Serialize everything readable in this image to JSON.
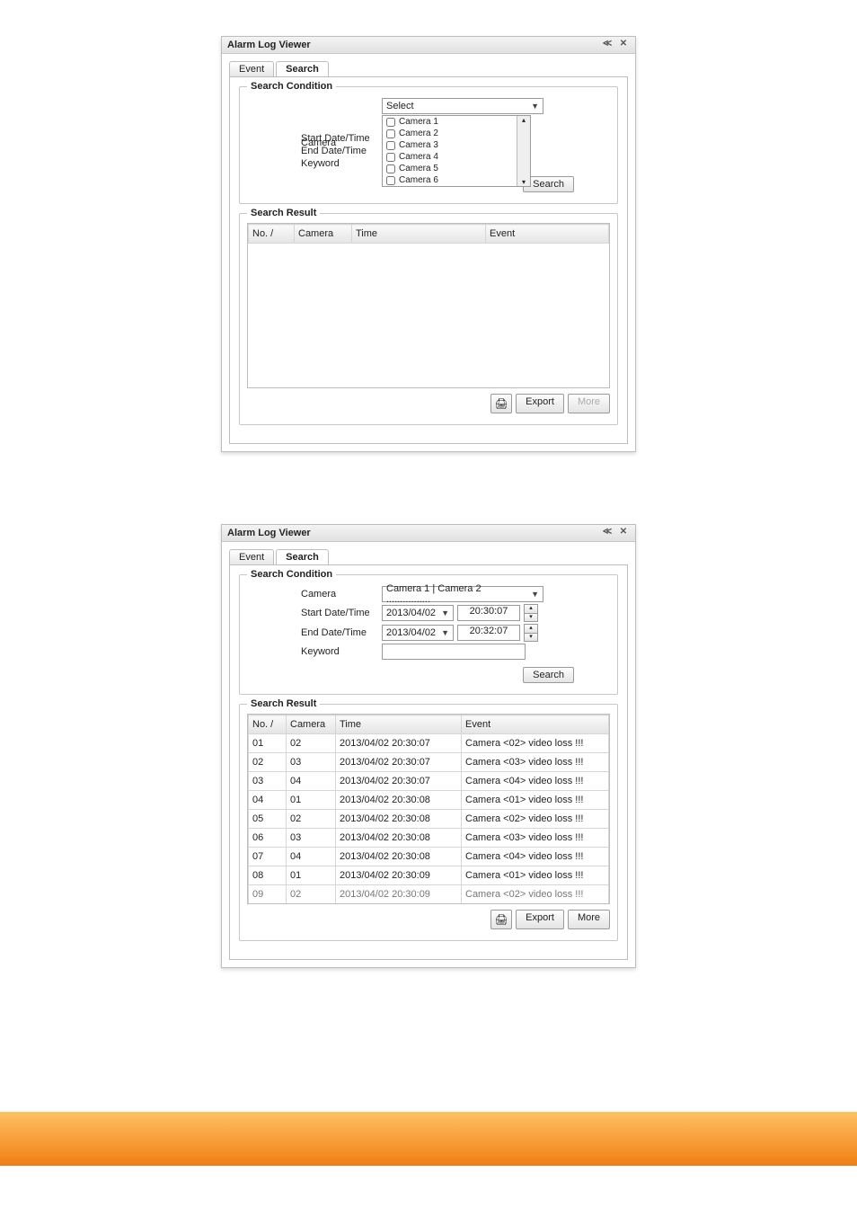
{
  "window": {
    "title": "Alarm Log Viewer",
    "pin_label": "≪",
    "close_label": "✕"
  },
  "tabs": {
    "event": "Event",
    "search": "Search"
  },
  "groupbox": {
    "search_condition": "Search Condition",
    "search_result": "Search Result"
  },
  "labels": {
    "camera": "Camera",
    "start_datetime": "Start Date/Time",
    "end_datetime": "End Date/Time",
    "keyword": "Keyword"
  },
  "buttons": {
    "search": "Search",
    "export": "Export",
    "more": "More"
  },
  "columns": {
    "no": "No.  /",
    "camera": "Camera",
    "time": "Time",
    "event": "Event"
  },
  "screenshot1": {
    "camera_select": "Select",
    "camera_list": [
      "Camera 1",
      "Camera 2",
      "Camera 3",
      "Camera 4",
      "Camera 5",
      "Camera 6"
    ]
  },
  "screenshot2": {
    "camera_select": "Camera 1 | Camera 2  ................",
    "start_date": "2013/04/02",
    "start_time": "20:30:07",
    "end_date": "2013/04/02",
    "end_time": "20:32:07",
    "rows": [
      {
        "no": "01",
        "camera": "02",
        "time": "2013/04/02 20:30:07",
        "event": "Camera <02> video loss !!!"
      },
      {
        "no": "02",
        "camera": "03",
        "time": "2013/04/02 20:30:07",
        "event": "Camera <03> video loss !!!"
      },
      {
        "no": "03",
        "camera": "04",
        "time": "2013/04/02 20:30:07",
        "event": "Camera <04> video loss !!!"
      },
      {
        "no": "04",
        "camera": "01",
        "time": "2013/04/02 20:30:08",
        "event": "Camera <01> video loss !!!"
      },
      {
        "no": "05",
        "camera": "02",
        "time": "2013/04/02 20:30:08",
        "event": "Camera <02> video loss !!!"
      },
      {
        "no": "06",
        "camera": "03",
        "time": "2013/04/02 20:30:08",
        "event": "Camera <03> video loss !!!"
      },
      {
        "no": "07",
        "camera": "04",
        "time": "2013/04/02 20:30:08",
        "event": "Camera <04> video loss !!!"
      },
      {
        "no": "08",
        "camera": "01",
        "time": "2013/04/02 20:30:09",
        "event": "Camera <01> video loss !!!"
      }
    ],
    "clipped_row": {
      "no": "09",
      "camera": "02",
      "time": "2013/04/02 20:30:09",
      "event": "Camera <02> video loss !!!"
    }
  }
}
